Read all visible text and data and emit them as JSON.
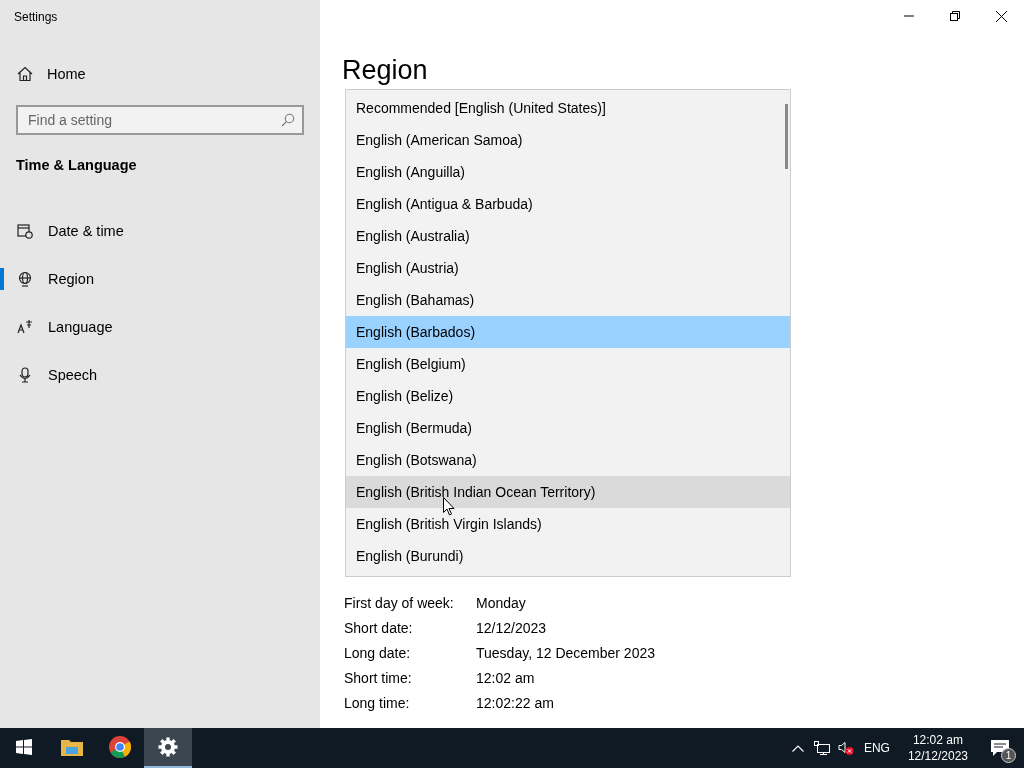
{
  "window": {
    "title": "Settings"
  },
  "sidebar": {
    "home": "Home",
    "search": {
      "placeholder": "Find a setting"
    },
    "section": "Time & Language",
    "items": [
      {
        "label": "Date & time",
        "kind": "calendar",
        "selected": false
      },
      {
        "label": "Region",
        "kind": "globe",
        "selected": true
      },
      {
        "label": "Language",
        "kind": "language",
        "selected": false
      },
      {
        "label": "Speech",
        "kind": "mic",
        "selected": false
      }
    ]
  },
  "page": {
    "title": "Region",
    "dropdown": {
      "items": [
        {
          "label": "Recommended [English (United States)]",
          "selected": false,
          "hovered": false
        },
        {
          "label": "English (American Samoa)",
          "selected": false,
          "hovered": false
        },
        {
          "label": "English (Anguilla)",
          "selected": false,
          "hovered": false
        },
        {
          "label": "English (Antigua & Barbuda)",
          "selected": false,
          "hovered": false
        },
        {
          "label": "English (Australia)",
          "selected": false,
          "hovered": false
        },
        {
          "label": "English (Austria)",
          "selected": false,
          "hovered": false
        },
        {
          "label": "English (Bahamas)",
          "selected": false,
          "hovered": false
        },
        {
          "label": "English (Barbados)",
          "selected": true,
          "hovered": false
        },
        {
          "label": "English (Belgium)",
          "selected": false,
          "hovered": false
        },
        {
          "label": "English (Belize)",
          "selected": false,
          "hovered": false
        },
        {
          "label": "English (Bermuda)",
          "selected": false,
          "hovered": false
        },
        {
          "label": "English (Botswana)",
          "selected": false,
          "hovered": false
        },
        {
          "label": "English (British Indian Ocean Territory)",
          "selected": false,
          "hovered": true
        },
        {
          "label": "English (British Virgin Islands)",
          "selected": false,
          "hovered": false
        },
        {
          "label": "English (Burundi)",
          "selected": false,
          "hovered": false
        }
      ]
    },
    "format": [
      {
        "label": "First day of week:",
        "value": "Monday"
      },
      {
        "label": "Short date:",
        "value": "12/12/2023"
      },
      {
        "label": "Long date:",
        "value": "Tuesday, 12 December 2023"
      },
      {
        "label": "Short time:",
        "value": "12:02 am"
      },
      {
        "label": "Long time:",
        "value": "12:02:22 am"
      }
    ]
  },
  "taskbar": {
    "apps": [
      {
        "kind": "start",
        "selected": false
      },
      {
        "kind": "folder",
        "selected": false
      },
      {
        "kind": "browser",
        "selected": false
      },
      {
        "kind": "settings",
        "selected": true
      }
    ],
    "language": "ENG",
    "time": "12:02 am",
    "date": "12/12/2023",
    "notifications": "1"
  }
}
